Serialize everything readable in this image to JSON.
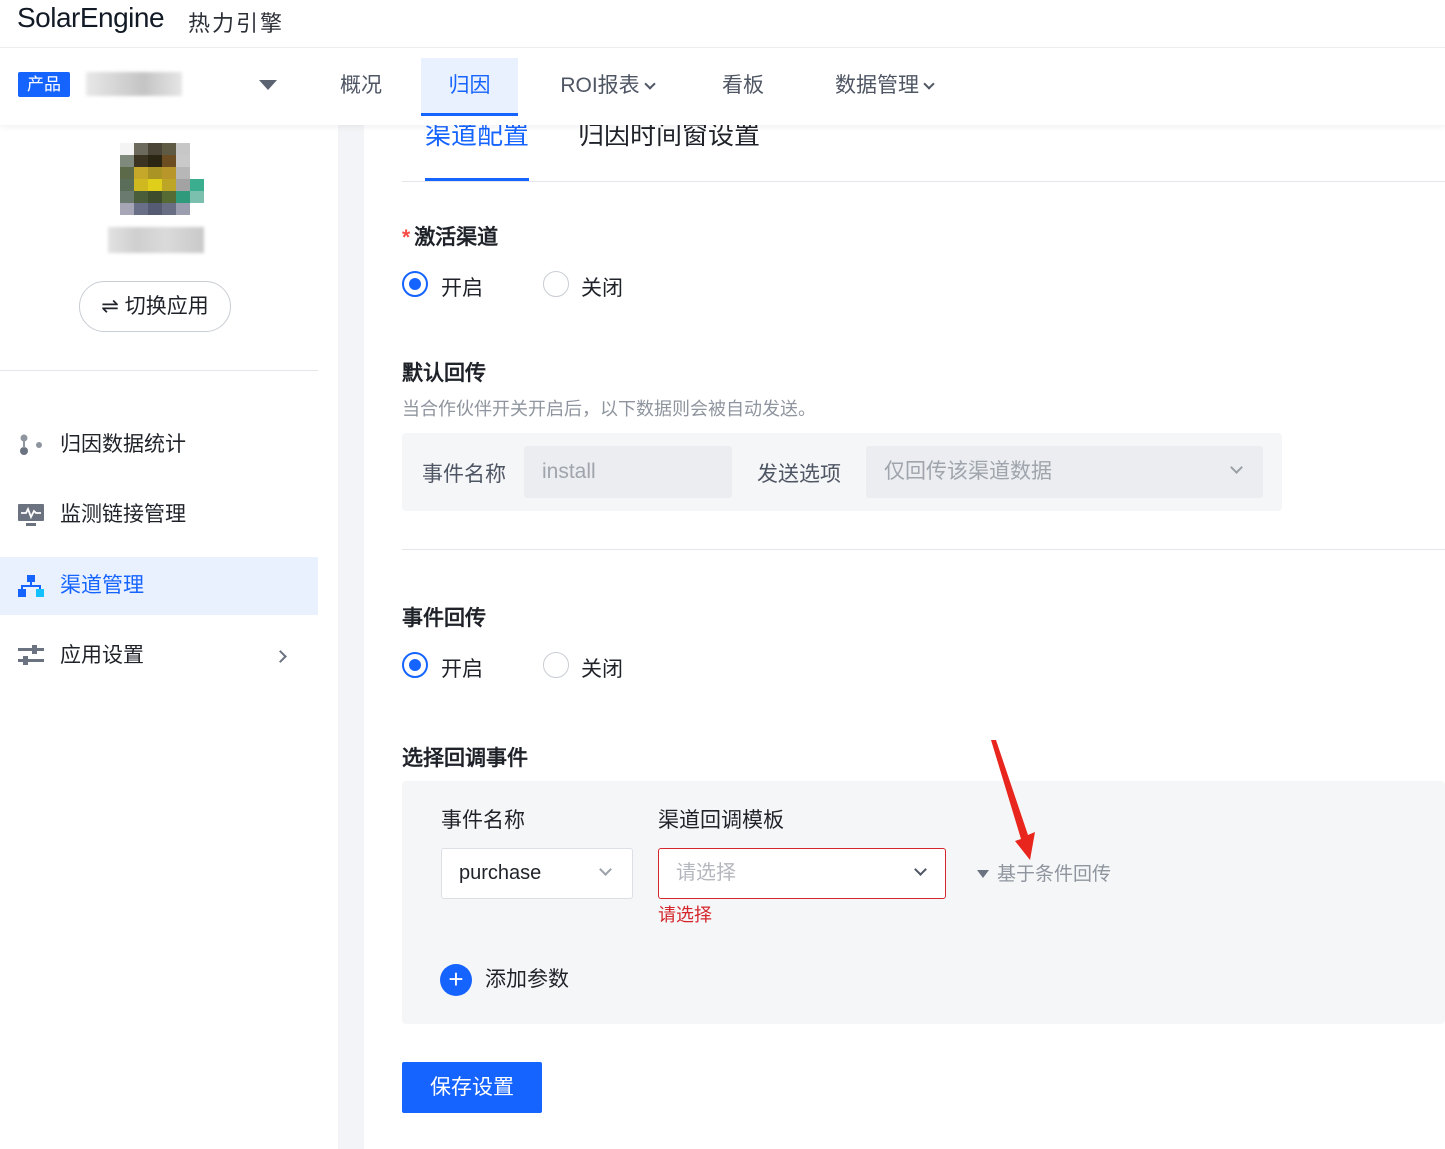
{
  "header": {
    "logo": "SolarEngine",
    "logo_sub": "热力引擎"
  },
  "nav": {
    "product_tag": "产品",
    "items": [
      {
        "label": "概况"
      },
      {
        "label": "归因"
      },
      {
        "label": "ROI报表"
      },
      {
        "label": "看板"
      },
      {
        "label": "数据管理"
      }
    ],
    "active_index": 1
  },
  "sidebar": {
    "switch_app": "⇌ 切换应用",
    "items": [
      {
        "label": "归因数据统计",
        "icon": "attribution-stats-icon"
      },
      {
        "label": "监测链接管理",
        "icon": "monitor-link-icon"
      },
      {
        "label": "渠道管理",
        "icon": "channel-tree-icon"
      },
      {
        "label": "应用设置",
        "icon": "sliders-icon"
      }
    ],
    "active_index": 2
  },
  "main": {
    "tabs": [
      {
        "label": "渠道配置"
      },
      {
        "label": "归因时间窗设置"
      }
    ],
    "active_tab": 0,
    "activation": {
      "title": "激活渠道",
      "required_mark": "*",
      "options": [
        "开启",
        "关闭"
      ],
      "selected": "开启"
    },
    "default_callback": {
      "title": "默认回传",
      "hint": "当合作伙伴开关开启后，以下数据则会被自动发送。",
      "event_label": "事件名称",
      "event_value": "install",
      "send_label": "发送选项",
      "send_value": "仅回传该渠道数据"
    },
    "event_callback": {
      "title": "事件回传",
      "options": [
        "开启",
        "关闭"
      ],
      "selected": "开启"
    },
    "select_callback": {
      "title": "选择回调事件",
      "event_col": "事件名称",
      "template_col": "渠道回调模板",
      "event_value": "purchase",
      "template_placeholder": "请选择",
      "template_error": "请选择",
      "condition_link": "基于条件回传",
      "add_param": "添加参数"
    },
    "save_button": "保存设置"
  },
  "colors": {
    "accent": "#1664ff",
    "error": "#d4262c",
    "annotation_arrow": "#e8261d"
  }
}
